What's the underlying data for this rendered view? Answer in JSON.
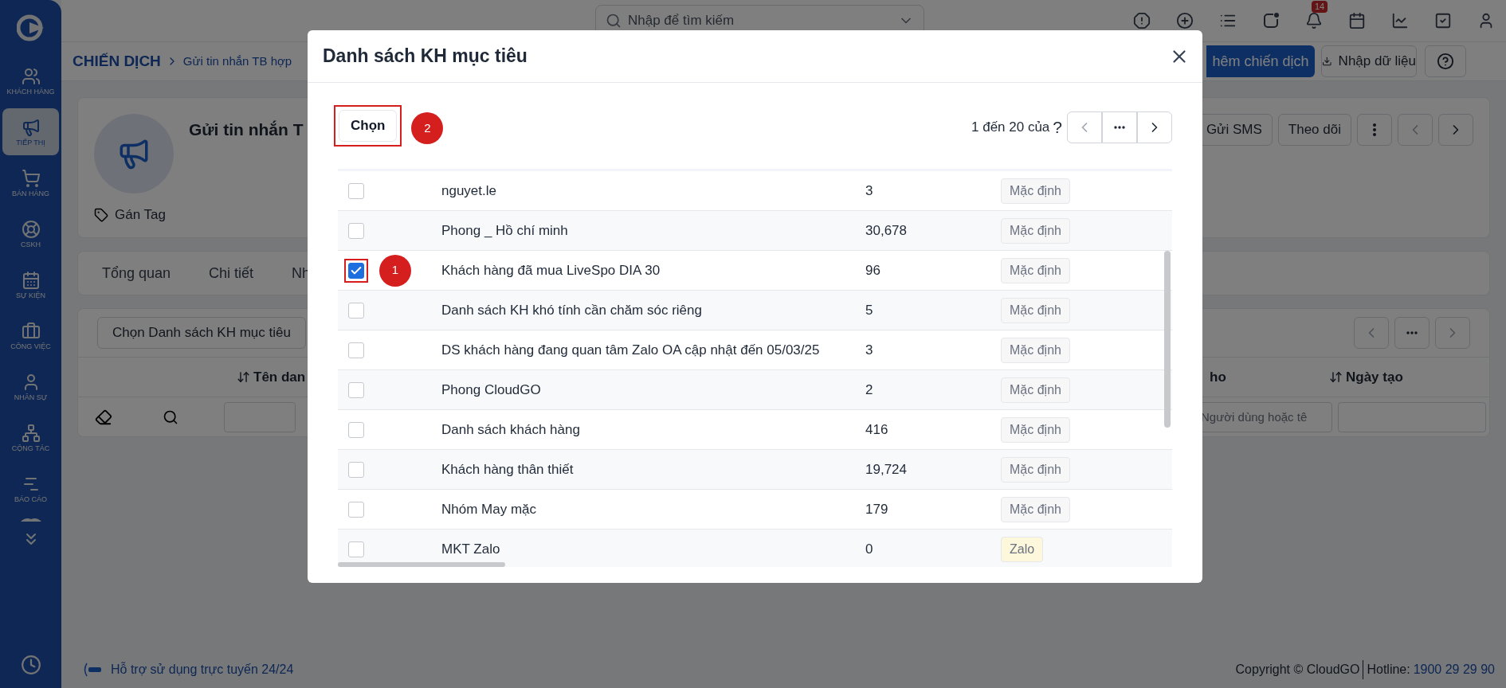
{
  "sidebar": {
    "items": [
      {
        "label": "KHÁCH HÀNG",
        "selected": false
      },
      {
        "label": "TIẾP THỊ",
        "selected": true
      },
      {
        "label": "BÁN HÀNG",
        "selected": false
      },
      {
        "label": "CSKH",
        "selected": false
      },
      {
        "label": "SỰ KIỆN",
        "selected": false
      },
      {
        "label": "CÔNG VIỆC",
        "selected": false
      },
      {
        "label": "NHÂN SỰ",
        "selected": false
      },
      {
        "label": "CỘNG TÁC",
        "selected": false
      },
      {
        "label": "BÁO CÁO",
        "selected": false
      }
    ]
  },
  "topbar": {
    "search_placeholder": "Nhập để tìm kiếm",
    "notification_count": "14"
  },
  "breadcrumb": {
    "section": "CHIẾN DỊCH",
    "current": "Gửi tin nhắn TB hợp"
  },
  "header_buttons": {
    "add": "hêm chiến dịch",
    "import": "Nhập dữ liệu"
  },
  "campaign": {
    "title": "Gửi tin nhắn T",
    "tag_action": "Gán Tag",
    "actions": [
      "Gửi SMS",
      "Theo dõi"
    ]
  },
  "tabs": [
    {
      "label": "Tổng quan",
      "selected": false
    },
    {
      "label": "Chi tiết",
      "selected": false
    },
    {
      "label": "Nh",
      "selected": false
    }
  ],
  "list_panel": {
    "select_button": "Chọn Danh sách KH mục tiêu",
    "columns": [
      "Tên dan",
      "ho",
      "Ngày tạo"
    ],
    "filter_placeholder": "Người dùng hoặc tê"
  },
  "footer": {
    "support": "Hỗ trợ sử dụng trực tuyến 24/24",
    "copyright": "Copyright © CloudGO",
    "hotline_label": "Hotline:",
    "hotline": "1900 29 29 90"
  },
  "modal": {
    "title": "Danh sách KH mục tiêu",
    "choose_button": "Chọn",
    "choose_callout": "2",
    "pagination": "1 đến 20 của",
    "pagination_unknown": "?",
    "rows": [
      {
        "name": "nguyet.le",
        "count": "3",
        "tag": "Mặc định",
        "color": "#f7f7f8",
        "checked": false
      },
      {
        "name": "Phong _ Hồ chí minh",
        "count": "30,678",
        "tag": "Mặc định",
        "color": "#f7f7f8",
        "checked": false
      },
      {
        "name": "Khách hàng đã mua LiveSpo DIA 30",
        "count": "96",
        "tag": "Mặc định",
        "color": "#f7f7f8",
        "checked": true,
        "callout": "1"
      },
      {
        "name": "Danh sách KH khó tính cần chăm sóc riêng",
        "count": "5",
        "tag": "Mặc định",
        "color": "#f7f7f8",
        "checked": false
      },
      {
        "name": "DS khách hàng đang quan tâm Zalo OA cập nhật đến 05/03/25",
        "count": "3",
        "tag": "Mặc định",
        "color": "#f7f7f8",
        "checked": false
      },
      {
        "name": "Phong CloudGO",
        "count": "2",
        "tag": "Mặc định",
        "color": "#f7f7f8",
        "checked": false
      },
      {
        "name": "Danh sách khách hàng",
        "count": "416",
        "tag": "Mặc định",
        "color": "#f7f7f8",
        "checked": false
      },
      {
        "name": "Khách hàng thân thiết",
        "count": "19,724",
        "tag": "Mặc định",
        "color": "#f7f7f8",
        "checked": false
      },
      {
        "name": "Nhóm May mặc",
        "count": "179",
        "tag": "Mặc định",
        "color": "#f7f7f8",
        "checked": false
      },
      {
        "name": "MKT Zalo",
        "count": "0",
        "tag": "Zalo",
        "color": "#fdf7dc",
        "checked": false
      }
    ]
  }
}
